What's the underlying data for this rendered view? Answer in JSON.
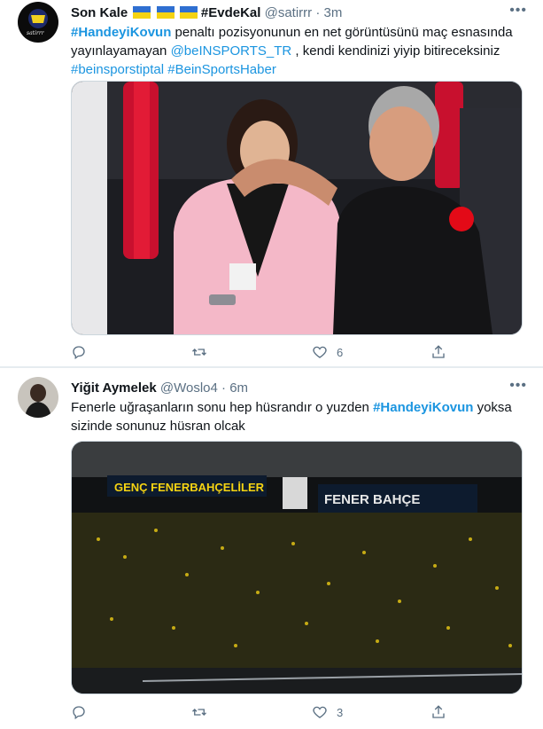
{
  "tweets": [
    {
      "name": "Son Kale",
      "hashtag_tag": "#EvdeKal",
      "handle": "@satirrr",
      "separator": "·",
      "time": "3m",
      "text": {
        "hashtag1": "#HandeyiKovun",
        "part1": " penaltı pozisyonunun en net görüntüsünü maç esnasında yayınlayamayan ",
        "mention": "@beINSPORTS_TR",
        "part2": " , kendi kendinizi yiyip bitireceksiniz ",
        "hashtag2": "#beinsporstiptal",
        "space": " ",
        "hashtag3": "#BeinSportsHaber"
      },
      "actions": {
        "reply": "",
        "retweet": "",
        "like": "6",
        "share": ""
      },
      "icons": {
        "reply": "reply-icon",
        "retweet": "retweet-icon",
        "like": "heart-icon",
        "share": "share-icon",
        "more": "more-icon"
      },
      "colors": {
        "flag_blue": "#2f6fd1",
        "flag_yellow": "#f5d312"
      }
    },
    {
      "name": "Yiğit Aymelek",
      "handle": "@Woslo4",
      "separator": "·",
      "time": "6m",
      "text": {
        "part1": "Fenerle uğraşanların sonu hep hüsrandır o yuzden ",
        "hashtag1": "#HandeyiKovun",
        "part2": " yoksa sizinde sonunuz hüsran olcak"
      },
      "actions": {
        "reply": "",
        "retweet": "",
        "like": "3",
        "share": ""
      }
    }
  ],
  "theme": {
    "link": "#1b95e0",
    "muted": "#5b7083",
    "text": "#0f1419",
    "border": "#e6ecf0"
  }
}
